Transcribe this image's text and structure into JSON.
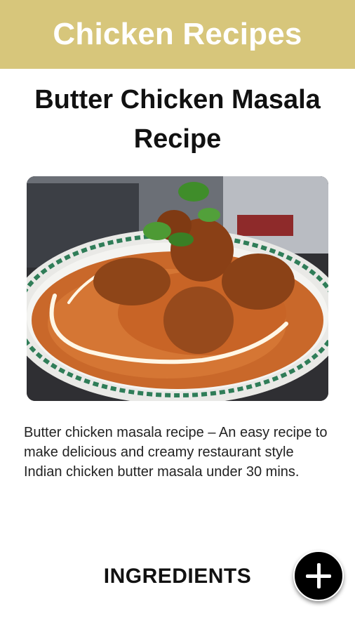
{
  "appbar": {
    "title": "Chicken Recipes",
    "color": "#d7c67b"
  },
  "recipe": {
    "title": "Butter Chicken Masala Recipe",
    "image_alt": "butter-chicken-photo",
    "description": "Butter chicken masala recipe – An easy recipe to make delicious and creamy restaurant style Indian chicken butter masala under 30 mins."
  },
  "sections": {
    "ingredients_heading": "INGREDIENTS"
  },
  "fab": {
    "icon": "plus-icon"
  }
}
